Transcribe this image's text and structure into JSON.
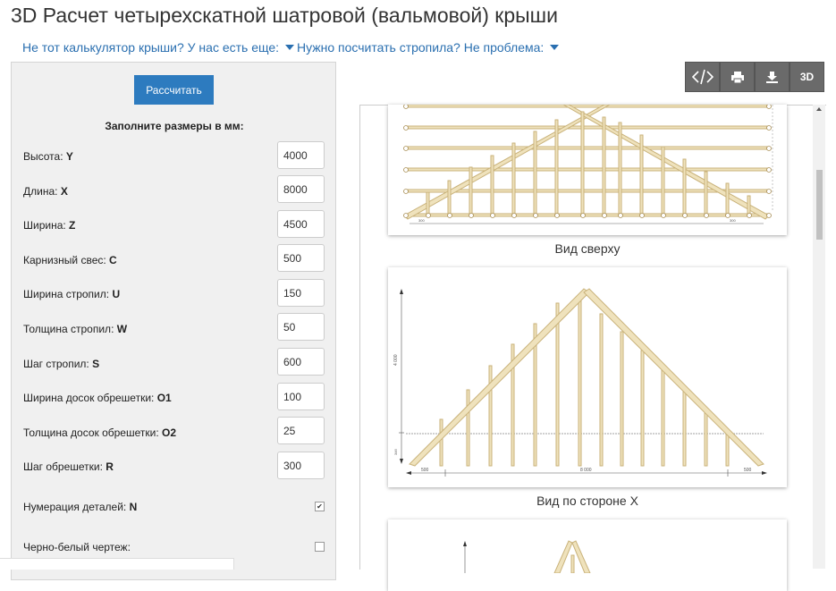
{
  "page": {
    "title": "3D Расчет четырехскатной шатровой (вальмовой) крыши",
    "dropdown_1": "Не тот калькулятор крыши? У нас есть еще:",
    "dropdown_2": "Нужно посчитать стропила? Не проблема:"
  },
  "form": {
    "calculate_label": "Рассчитать",
    "header": "Заполните размеры в мм:",
    "fields": [
      {
        "label": "Высота: ",
        "key": "Y",
        "value": "4000"
      },
      {
        "label": "Длина: ",
        "key": "X",
        "value": "8000"
      },
      {
        "label": "Ширина: ",
        "key": "Z",
        "value": "4500"
      },
      {
        "label": "Карнизный свес: ",
        "key": "C",
        "value": "500"
      },
      {
        "label": "Ширина стропил: ",
        "key": "U",
        "value": "150"
      },
      {
        "label": "Толщина стропил: ",
        "key": "W",
        "value": "50"
      },
      {
        "label": "Шаг стропил: ",
        "key": "S",
        "value": "600"
      },
      {
        "label": "Ширина досок обрешетки: ",
        "key": "O1",
        "value": "100"
      },
      {
        "label": "Толщина досок обрешетки: ",
        "key": "O2",
        "value": "25"
      },
      {
        "label": "Шаг обрешетки: ",
        "key": "R",
        "value": "300"
      }
    ],
    "numbering": {
      "label": "Нумерация деталей: ",
      "key": "N",
      "checked": true
    },
    "bw": {
      "label": "Черно-белый чертеж:",
      "checked": false
    }
  },
  "toolbar": {
    "code_icon": "code-icon",
    "print_icon": "printer-icon",
    "download_icon": "download-icon",
    "view3d_label": "3D"
  },
  "drawings": {
    "top_caption": "Вид сверху",
    "side_caption": "Вид по стороне X",
    "side_height_dim": "4 000",
    "side_length_dim": "8 000",
    "side_overhang_left": "500",
    "side_overhang_right": "500",
    "side_eave_dim": "346",
    "top_dim_left": "300",
    "top_dim_right": "300"
  },
  "colors": {
    "accent": "#2d7bbf",
    "wood": "#e8d7a8",
    "wood_stroke": "#c9b27a"
  }
}
